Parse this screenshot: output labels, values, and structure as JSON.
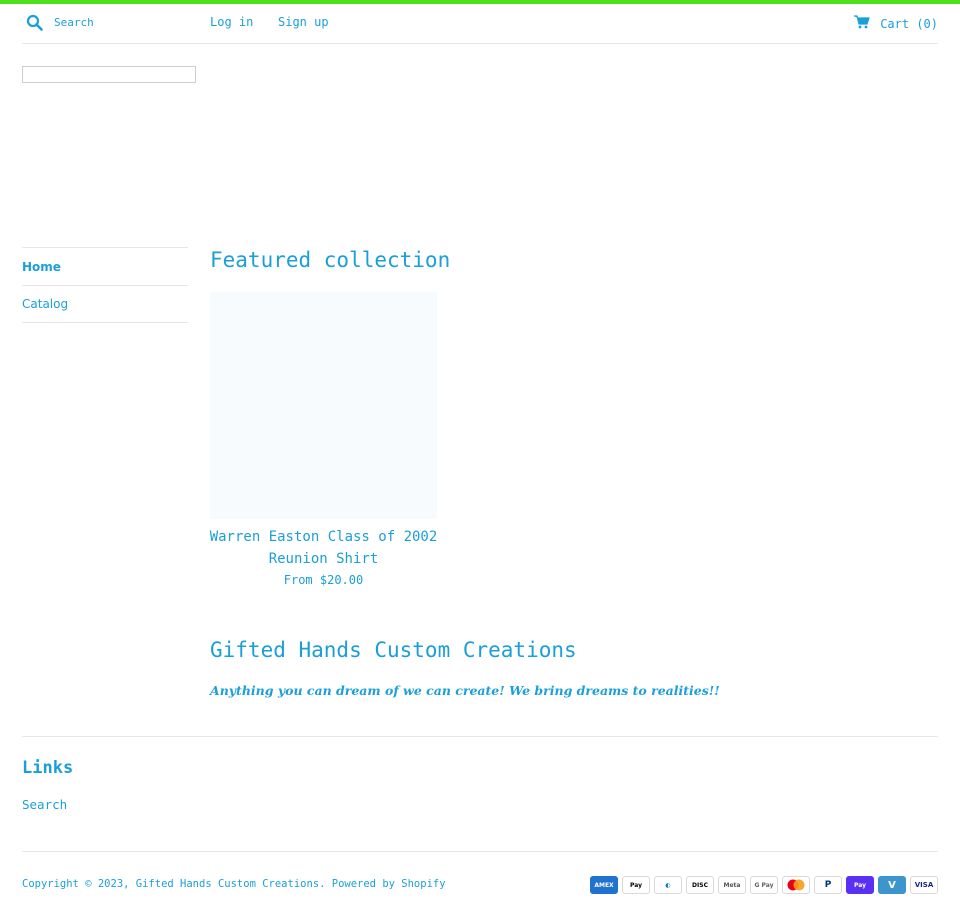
{
  "header": {
    "search_placeholder": "Search",
    "login_label": "Log in",
    "signup_label": "Sign up",
    "cart_label": "Cart (0)"
  },
  "sidebar": {
    "items": [
      {
        "label": "Home",
        "active": true
      },
      {
        "label": "Catalog",
        "active": false
      }
    ]
  },
  "featured": {
    "title": "Featured collection",
    "product": {
      "name": "Warren Easton Class of 2002 Reunion Shirt",
      "price": "From $20.00"
    }
  },
  "about": {
    "title": "Gifted Hands Custom Creations",
    "tagline": "Anything you can dream of we can create! We bring dreams to realities!!"
  },
  "footer": {
    "links_title": "Links",
    "links": [
      "Search"
    ],
    "copyright": "Copyright © 2023, Gifted Hands Custom Creations. Powered by Shopify",
    "payment_icons": [
      "american-express-icon",
      "apple-pay-icon",
      "diners-club-icon",
      "discover-icon",
      "meta-pay-icon",
      "google-pay-icon",
      "mastercard-icon",
      "paypal-icon",
      "shop-pay-icon",
      "venmo-icon",
      "visa-icon"
    ]
  },
  "colors": {
    "accent": "#1a9fd9",
    "top_bar": "#4ee01a"
  }
}
